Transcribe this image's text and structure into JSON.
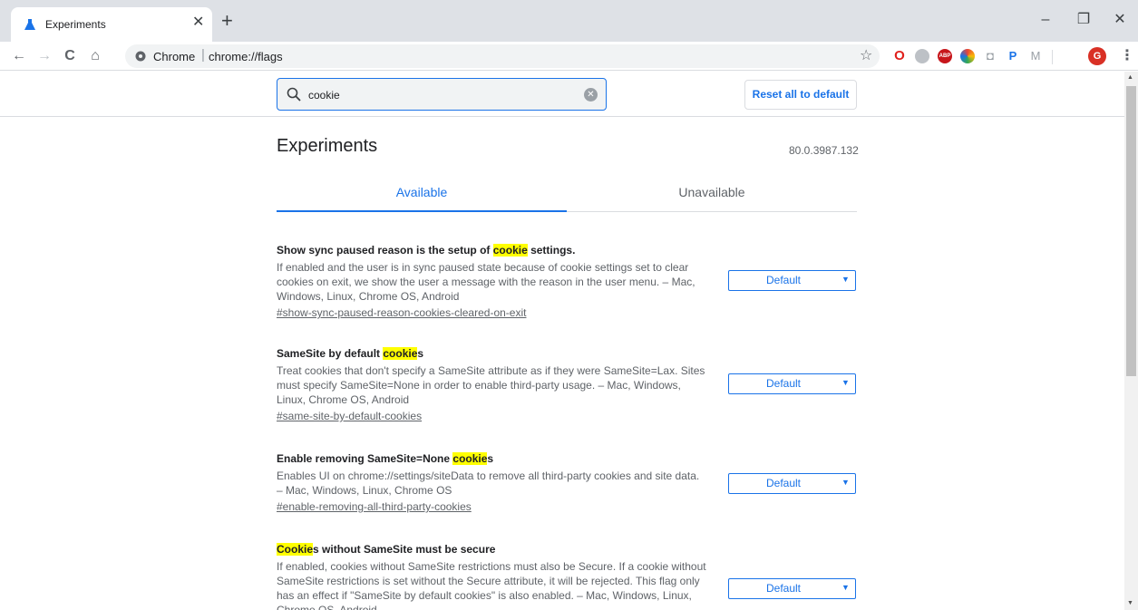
{
  "browser": {
    "tab": {
      "title": "Experiments",
      "close_glyph": "✕"
    },
    "new_tab_glyph": "+",
    "window_controls": {
      "minimize": "–",
      "restore": "❐",
      "close": "✕"
    },
    "nav": {
      "back": "←",
      "forward": "→",
      "reload": "C",
      "home": "⌂"
    },
    "omnibox": {
      "site_label": "Chrome",
      "separator": "|",
      "url": "chrome://flags",
      "star": "☆"
    },
    "extensions": [
      {
        "name": "opera-icon",
        "label": "O",
        "color": "#e0201c"
      },
      {
        "name": "gray-extension-icon",
        "label": "",
        "color": "#9aa0a6"
      },
      {
        "name": "adblock-plus-icon",
        "label": "ABP",
        "color": "#c7161b"
      },
      {
        "name": "color-picker-icon",
        "label": "",
        "color": "#1a73e8"
      },
      {
        "name": "camera-icon",
        "label": "◘",
        "color": "#9aa0a6"
      },
      {
        "name": "pushbullet-icon",
        "label": "P",
        "color": "#1a73e8"
      },
      {
        "name": "gmail-icon",
        "label": "M",
        "color": "#9aa0a6"
      }
    ],
    "profile": {
      "initial": "G",
      "color": "#d93025"
    },
    "menu_glyph": "⋮"
  },
  "search": {
    "value": "cookie",
    "clear_glyph": "✕"
  },
  "reset_button": {
    "label": "Reset all to default"
  },
  "page": {
    "title": "Experiments",
    "version": "80.0.3987.132"
  },
  "tabs": [
    {
      "label": "Available",
      "selected": true
    },
    {
      "label": "Unavailable",
      "selected": false
    }
  ],
  "experiments": [
    {
      "title_pre": "Show sync paused reason is the setup of ",
      "title_hl": "cookie",
      "title_post": " settings.",
      "description": "If enabled and the user is in sync paused state because of cookie settings set to clear cookies on exit, we show the user a message with the reason in the user menu. – Mac, Windows, Linux, Chrome OS, Android",
      "link": "#show-sync-paused-reason-cookies-cleared-on-exit",
      "select": "Default"
    },
    {
      "title_pre": "SameSite by default ",
      "title_hl": "cookie",
      "title_post": "s",
      "description": "Treat cookies that don't specify a SameSite attribute as if they were SameSite=Lax. Sites must specify SameSite=None in order to enable third-party usage. – Mac, Windows, Linux, Chrome OS, Android",
      "link": "#same-site-by-default-cookies",
      "select": "Default"
    },
    {
      "title_pre": "Enable removing SameSite=None ",
      "title_hl": "cookie",
      "title_post": "s",
      "description": "Enables UI on chrome://settings/siteData to remove all third-party cookies and site data. – Mac, Windows, Linux, Chrome OS",
      "link": "#enable-removing-all-third-party-cookies",
      "select": "Default"
    },
    {
      "title_pre": "",
      "title_hl": "Cookie",
      "title_post": "s without SameSite must be secure",
      "description": "If enabled, cookies without SameSite restrictions must also be Secure. If a cookie without SameSite restrictions is set without the Secure attribute, it will be rejected. This flag only has an effect if \"SameSite by default cookies\" is also enabled. – Mac, Windows, Linux, Chrome OS, Android",
      "link": "",
      "select": "Default"
    }
  ],
  "colors": {
    "accent": "#1a73e8",
    "highlight": "#ffff00",
    "tabstrip": "#dee1e6"
  }
}
